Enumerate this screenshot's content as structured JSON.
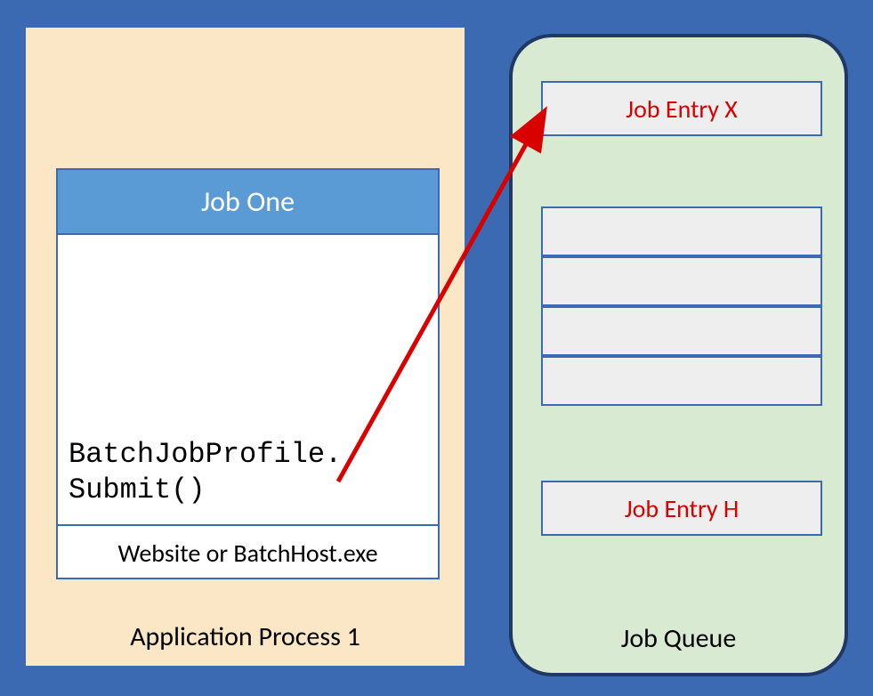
{
  "app_process": {
    "label": "Application Process 1"
  },
  "job_card": {
    "title": "Job One",
    "code": "BatchJobProfile.\nSubmit()",
    "footer": "Website or BatchHost.exe"
  },
  "queue": {
    "label": "Job Queue",
    "entry_x": "Job Entry X",
    "entry_h": "Job Entry H"
  },
  "colors": {
    "background": "#3c6ab2",
    "app_bg": "#fbe7c6",
    "queue_bg": "#d9ead3",
    "header_blue": "#5b9bd5",
    "arrow": "#d90000"
  }
}
